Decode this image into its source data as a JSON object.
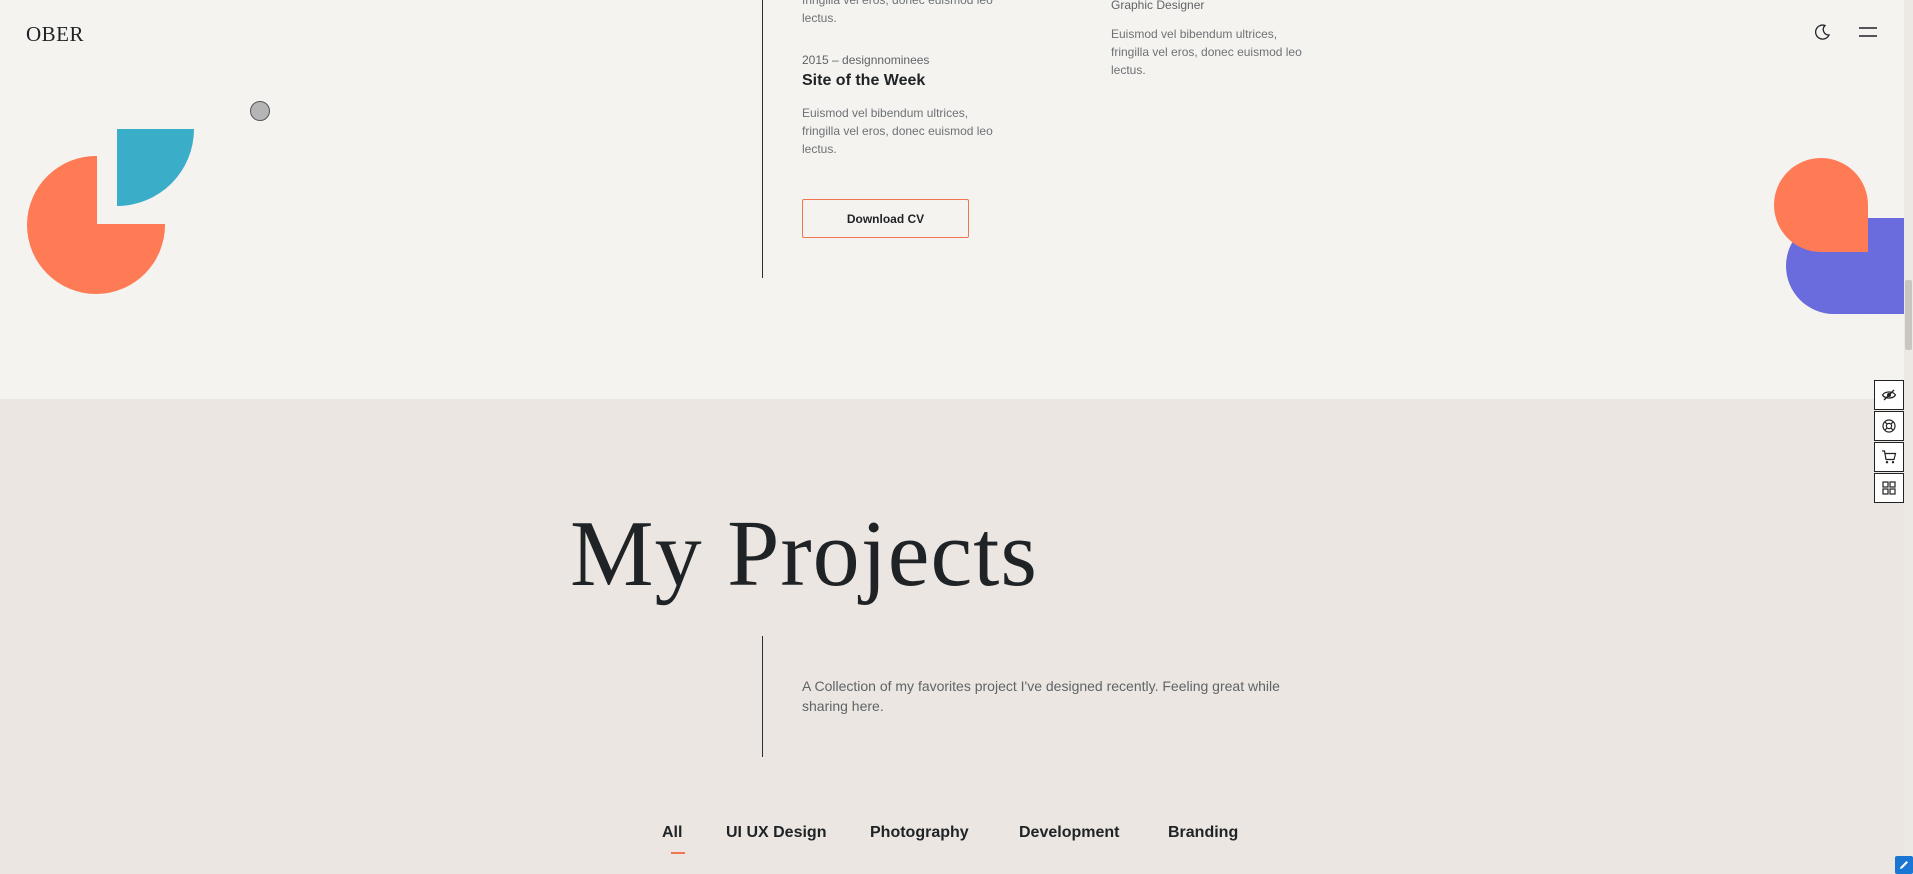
{
  "header": {
    "logo": "OBER",
    "theme_toggle_icon": "moon-icon",
    "menu_icon": "hamburger-menu-icon"
  },
  "experience": {
    "cut_off_desc": "fringilla vel eros, donec euismod leo lectus.",
    "item": {
      "meta": "2015 – designnominees",
      "title": "Site of the Week",
      "desc": "Euismod vel bibendum ultrices, fringilla vel eros, donec euismod leo lectus."
    },
    "right_item": {
      "role": "Graphic Designer",
      "desc": "Euismod vel bibendum ultrices, fringilla vel eros, donec euismod leo lectus."
    },
    "download_label": "Download CV"
  },
  "projects": {
    "title": "My Projects",
    "description": "A Collection of my favorites project I've designed recently. Feeling great while sharing here.",
    "filters": [
      "All",
      "UI UX Design",
      "Photography",
      "Development",
      "Branding"
    ],
    "active_filter": "All"
  },
  "side_tools": [
    "eye-slash-icon",
    "lifebuoy-icon",
    "cart-icon",
    "grid-icon"
  ],
  "colors": {
    "accent": "#f0764f",
    "teal": "#3aadc8",
    "purple": "#6a6bdc",
    "coral": "#ff7b55",
    "bg_light": "#f5f3f0",
    "bg_section": "#ebe6e1",
    "text_dark": "#1f2326"
  }
}
